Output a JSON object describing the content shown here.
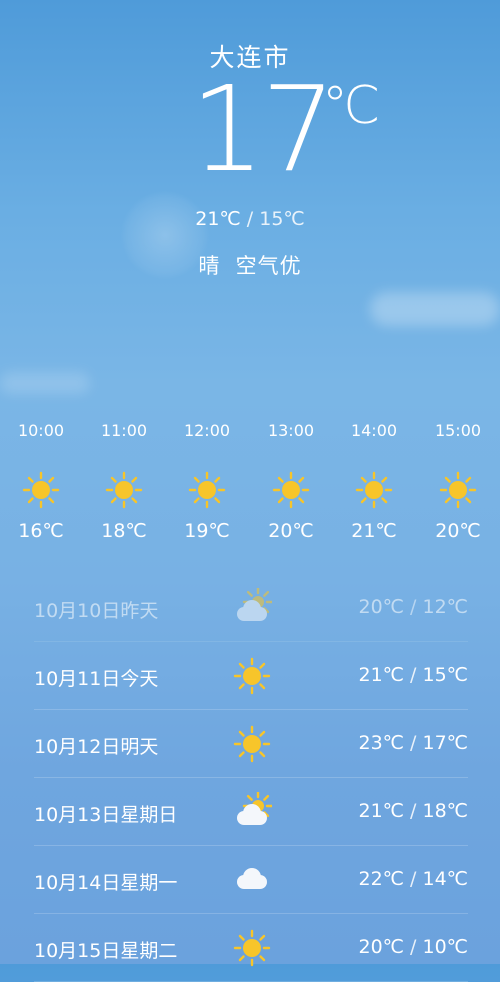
{
  "header": {
    "city": "大连市",
    "current_temp": "17",
    "unit": "℃",
    "high": "21℃",
    "separator": " / ",
    "low": "15℃",
    "condition": "晴",
    "air_quality": "空气优"
  },
  "hourly": [
    {
      "time": "10:00",
      "icon": "sun-icon",
      "temp": "16℃"
    },
    {
      "time": "11:00",
      "icon": "sun-icon",
      "temp": "18℃"
    },
    {
      "time": "12:00",
      "icon": "sun-icon",
      "temp": "19℃"
    },
    {
      "time": "13:00",
      "icon": "sun-icon",
      "temp": "20℃"
    },
    {
      "time": "14:00",
      "icon": "sun-icon",
      "temp": "21℃"
    },
    {
      "time": "15:00",
      "icon": "sun-icon",
      "temp": "20℃"
    }
  ],
  "daily": [
    {
      "date": "10月10日昨天",
      "icon": "partly-cloudy-icon",
      "high": "20℃",
      "sep": " / ",
      "low": "12℃"
    },
    {
      "date": "10月11日今天",
      "icon": "sun-icon",
      "high": "21℃",
      "sep": " / ",
      "low": "15℃"
    },
    {
      "date": "10月12日明天",
      "icon": "sun-icon",
      "high": "23℃",
      "sep": " / ",
      "low": "17℃"
    },
    {
      "date": "10月13日星期日",
      "icon": "partly-cloudy-icon",
      "high": "21℃",
      "sep": " / ",
      "low": "18℃"
    },
    {
      "date": "10月14日星期一",
      "icon": "cloud-icon",
      "high": "22℃",
      "sep": " / ",
      "low": "14℃"
    },
    {
      "date": "10月15日星期二",
      "icon": "sun-icon",
      "high": "20℃",
      "sep": " / ",
      "low": "10℃"
    }
  ],
  "colors": {
    "sun": "#f7c52a",
    "sky_top": "#4f9bd9",
    "sky_bottom": "#6ba2dd"
  }
}
